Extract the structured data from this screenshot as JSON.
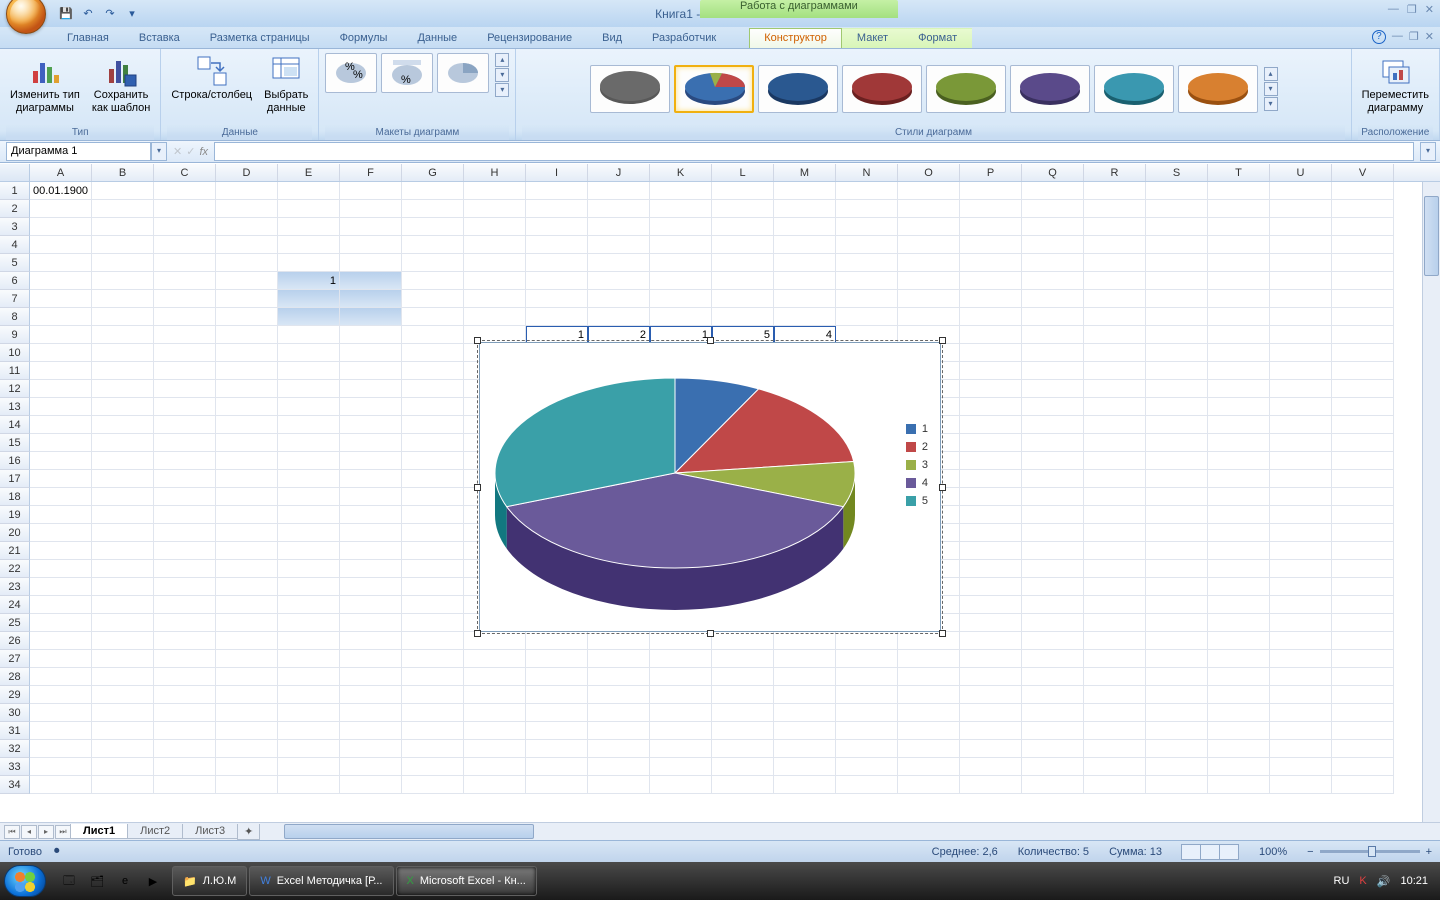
{
  "titlebar": {
    "title": "Книга1 - Microsoft Excel",
    "chart_tools": "Работа с диаграммами"
  },
  "ribbon_tabs": {
    "home": "Главная",
    "insert": "Вставка",
    "layout": "Разметка страницы",
    "formulas": "Формулы",
    "data": "Данные",
    "review": "Рецензирование",
    "view": "Вид",
    "developer": "Разработчик",
    "design": "Конструктор",
    "chart_layout": "Макет",
    "format": "Формат"
  },
  "ribbon": {
    "type": {
      "label": "Тип",
      "change": "Изменить тип\nдиаграммы",
      "save": "Сохранить\nкак шаблон"
    },
    "data": {
      "label": "Данные",
      "switch": "Строка/столбец",
      "select": "Выбрать\nданные"
    },
    "layouts": {
      "label": "Макеты диаграмм"
    },
    "styles": {
      "label": "Стили диаграмм"
    },
    "location": {
      "label": "Расположение",
      "move": "Переместить\nдиаграмму"
    }
  },
  "namebox": "Диаграмма 1",
  "cells": {
    "A1": "00.01.1900",
    "E6": "1",
    "I9": "1",
    "J9": "2",
    "K9": "1",
    "L9": "5",
    "M9": "4"
  },
  "chart_data": {
    "type": "pie",
    "categories": [
      "1",
      "2",
      "3",
      "4",
      "5"
    ],
    "values": [
      1,
      2,
      1,
      5,
      4
    ],
    "colors": [
      "#3a6fb0",
      "#c04848",
      "#9ab048",
      "#6a5a9a",
      "#3aa0a8"
    ],
    "legend_position": "right",
    "title": "",
    "xlabel": "",
    "ylabel": ""
  },
  "sheets": {
    "s1": "Лист1",
    "s2": "Лист2",
    "s3": "Лист3"
  },
  "statusbar": {
    "ready": "Готово",
    "avg": "Среднее: 2,6",
    "count": "Количество: 5",
    "sum": "Сумма: 13",
    "zoom": "100%"
  },
  "taskbar": {
    "folder": "Л.Ю.М",
    "word": "Excel Методичка [Р...",
    "excel": "Microsoft Excel - Кн...",
    "lang": "RU",
    "time": "10:21"
  },
  "columns": [
    "A",
    "B",
    "C",
    "D",
    "E",
    "F",
    "G",
    "H",
    "I",
    "J",
    "K",
    "L",
    "M",
    "N",
    "O",
    "P",
    "Q",
    "R",
    "S",
    "T",
    "U",
    "V"
  ]
}
